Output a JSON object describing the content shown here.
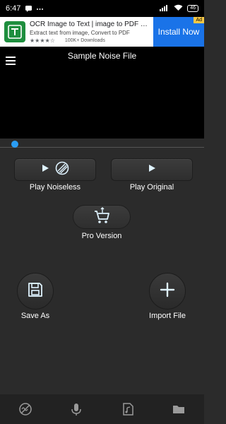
{
  "status_bar": {
    "time": "6:47",
    "battery": "46"
  },
  "ad": {
    "title": "OCR Image to Text | image to PDF co...",
    "subtitle": "Extract text from image, Convert to PDF",
    "rating": 4.5,
    "stars": "★★★★☆",
    "downloads": "100K+ Downloads",
    "install_label": "Install Now",
    "badge": "Ad",
    "logo_icon": "ocr-app-icon",
    "colors": {
      "install": "#1a73e8",
      "logo": "#1e8e3e"
    }
  },
  "header": {
    "title": "Sample Noise File",
    "menu_icon": "hamburger-icon"
  },
  "seekbar": {
    "progress": 0.0,
    "accent": "#2a9df4"
  },
  "controls": {
    "play_noiseless_label": "Play Noiseless",
    "play_original_label": "Play Original",
    "pro_version_label": "Pro Version",
    "save_as_label": "Save As",
    "import_file_label": "Import File"
  },
  "icons": {
    "play": "play-icon",
    "noise_filter": "noise-filter-icon",
    "cart": "shopping-cart-icon",
    "save": "floppy-disk-icon",
    "add": "plus-icon"
  },
  "bottom_nav": {
    "items": [
      {
        "icon": "noise-off-icon"
      },
      {
        "icon": "microphone-icon"
      },
      {
        "icon": "audio-file-icon"
      },
      {
        "icon": "folder-icon"
      }
    ]
  },
  "colors": {
    "accent_blue": "#2a9df4",
    "background": "#2b2b2b"
  }
}
